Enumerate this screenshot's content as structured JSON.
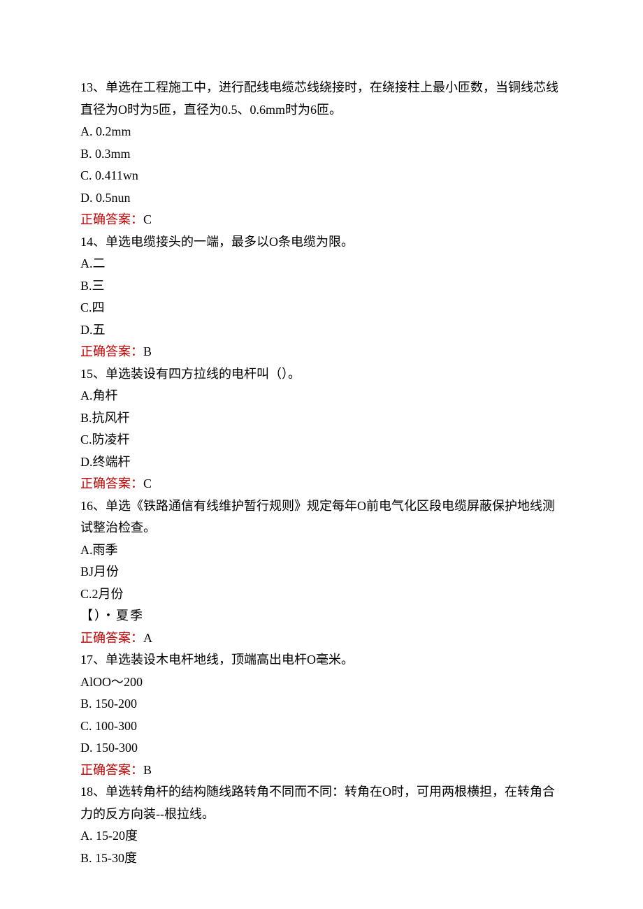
{
  "q13": {
    "stem": "13、单选在工程施工中，进行配线电缆芯线绕接时，在绕接柱上最小匝数，当铜线芯线直径为O时为5匝，直径为0.5、0.6mm时为6匝。",
    "optA": "A.  0.2mm",
    "optB": "B.  0.3mm",
    "optC": "C.  0.411wn",
    "optD": "D.  0.5nun",
    "answerLabel": "正确答案：",
    "answerValue": "C"
  },
  "q14": {
    "stem": "14、单选电缆接头的一端，最多以O条电缆为限。",
    "optA": "A.二",
    "optB": "B.三",
    "optC": "C.四",
    "optD": "D.五",
    "answerLabel": "正确答案：",
    "answerValue": "B"
  },
  "q15": {
    "stem": "15、单选装设有四方拉线的电杆叫（）。",
    "optA": "A.角杆",
    "optB": "B.抗风杆",
    "optC": "C.防凌杆",
    "optD": "D.终端杆",
    "answerLabel": "正确答案：",
    "answerValue": "C"
  },
  "q16": {
    "stem": "16、单选《铁路通信有线维护暂行规则》规定每年O前电气化区段电缆屏蔽保护地线测试整治检查。",
    "optA": "A.雨季",
    "optB": "BJ月份",
    "optC": "C.2月份",
    "optD": "【）・夏季",
    "answerLabel": "正确答案：",
    "answerValue": "A"
  },
  "q17": {
    "stem": "17、单选装设木电杆地线，顶端高出电杆O毫米。",
    "optA": "AlOO～200",
    "optB": "B.  150-200",
    "optC": "C.  100-300",
    "optD": "D.  150-300",
    "answerLabel": "正确答案：",
    "answerValue": "B"
  },
  "q18": {
    "stem": "18、单选转角杆的结构随线路转角不同而不同：转角在O时，可用两根横担，在转角合力的反方向装--根拉线。",
    "optA": "A.  15-20度",
    "optB": "B.  15-30度"
  }
}
